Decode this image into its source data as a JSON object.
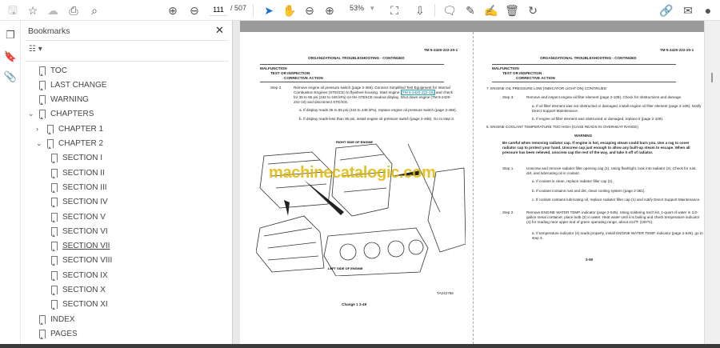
{
  "toolbar": {
    "page_current": "111",
    "page_total": "/ 507",
    "zoom": "53%"
  },
  "icons": [
    "save-icon",
    "bookmark-star-icon",
    "cloud-upload-icon",
    "print-icon",
    "search-zoom-icon",
    "page-up-icon",
    "page-down-icon",
    "select-cursor-icon",
    "hand-icon",
    "zoom-out-icon",
    "zoom-in-icon",
    "fit-page-icon",
    "scroll-mode-icon",
    "comment-icon",
    "highlight-pen-icon",
    "sign-icon",
    "delete-icon",
    "rotate-icon",
    "share-link-icon",
    "email-icon",
    "account-icon"
  ],
  "panel": {
    "title": "Bookmarks",
    "close": "✕"
  },
  "bookmarks": [
    {
      "label": "TOC",
      "level": 0,
      "chevron": ""
    },
    {
      "label": "LAST CHANGE",
      "level": 0,
      "chevron": ""
    },
    {
      "label": "WARNING",
      "level": 0,
      "chevron": ""
    },
    {
      "label": "CHAPTERS",
      "level": 0,
      "chevron": "⌄"
    },
    {
      "label": "CHAPTER 1",
      "level": 1,
      "chevron": "›"
    },
    {
      "label": "CHAPTER 2",
      "level": 1,
      "chevron": "⌄"
    },
    {
      "label": "SECTION I",
      "level": 2
    },
    {
      "label": "SECTION II",
      "level": 2
    },
    {
      "label": "SECTION III",
      "level": 2
    },
    {
      "label": "SECTION IV",
      "level": 2
    },
    {
      "label": "SECTION V",
      "level": 2
    },
    {
      "label": "SECTION VI",
      "level": 2
    },
    {
      "label": "SECTION VII",
      "level": 2
    },
    {
      "label": "SECTION VIII",
      "level": 2
    },
    {
      "label": "SECTION IX",
      "level": 2
    },
    {
      "label": "SECTION X",
      "level": 2
    },
    {
      "label": "SECTION XI",
      "level": 2
    },
    {
      "label": "INDEX",
      "level": 0,
      "chevron": ""
    },
    {
      "label": "PAGES",
      "level": 0,
      "chevron": ""
    }
  ],
  "left_page": {
    "tm": "TM 5-2420-222-20-1",
    "heading": "ORGANIZATIONAL TROUBLESHOOTING - CONTINUED",
    "col1": "MALFUNCTION",
    "col2": "TEST OR INSPECTION",
    "col3": "CORRECTIVE ACTION",
    "step": "Step 2.",
    "step_text_a": "Remove engine oil pressure switch (page 2-466). Connect Simplified Test Equipment for Internal Combustion Engines (STE/ICE) to flywheel housing. Start engine ",
    "step_link": "(TM 5-2420-222-10)",
    "step_text_b": " and check for 35 to 65 psi (242 to 448 kPa) on the STE/ICE readout display. Shut down engine (TM 5-2420-222-10) and disconnect STE/ICE.",
    "a": "a.  If display reads 35 to 65 psi (242 to 448 kPa), replace engine oil pressure switch (page 2-466).",
    "b": "b.  If display reads less than 35 psi, install engine oil pressure switch (page 2-466). Go to step 3.",
    "fig_right": "RIGHT SIDE OF ENGINE",
    "fig_left": "LEFT SIDE OF ENGINE",
    "fig_id": "TA242756",
    "footer": "Change 1  2-49",
    "watermark": "machinecatalogic.com"
  },
  "right_page": {
    "tm": "TM 5-2420-222-20-1",
    "heading": "ORGANIZATIONAL TROUBLESHOOTING - CONTINUED",
    "col1": "MALFUNCTION",
    "col2": "TEST OR INSPECTION",
    "col3": "CORRECTIVE ACTION",
    "item7": "7.   ENGINE OIL PRESSURE LOW (INDICATOR LIGHT ON) CONTINUED",
    "s3": "Step 3.",
    "s3_text": "Remove and inspect engine oil filter element (page 2-109). Check for obstructions and damage.",
    "s3a": "a.  If oil filter element was not obstructed or damaged, install engine oil filter element (page 2-109). Notify Direct Support Maintenance.",
    "s3b": "b.  If engine oil filter element was obstructed or damaged, replace it (page 2-109).",
    "item8": "8.   ENGINE COOLANT TEMPERATURE TOO HIGH (GAGE READS IN OVERHEAT RANGE)",
    "warning": "WARNING",
    "warning_text": "Be careful when removing radiator cap. If engine is hot, escaping steam could burn you. Use a rag to cover radiator cap to protect your hand. Unscrew cap just enough to allow any built-up steam to escape. When all pressure has been relieved, unscrew cap the rest of the way, and take it off of radiator.",
    "s1": "Step 1.",
    "s1_text": "Unscrew and remove radiator filler opening cap (1). Using flashlight, look into radiator (2). Check for rust, dirt, and lubricating oil in coolant.",
    "s1a": "a.  If coolant is clean, replace radiator filler cap (1).",
    "s1b": "b.  If coolant contains rust and dirt, clean cooling system (page 2-381).",
    "s1c": "c.  If coolant contains lubricating oil, replace radiator filler cap (1) and notify Direct Support Maintenance.",
    "s2": "Step 2.",
    "s2_text": "Remove ENGINE WATER TEMP. indicator (page 2-545). Using soldering torch kit, 1-quart of water in 1/2-gallon metal container, place bulb (3) in water. Heat water until it is boiling and check temperature indicator (4) for reading near upper end of green operating range, about 212ºF (100ºC).",
    "s2a": "a.  If temperature indicator (4) reads properly, install ENGINE WATER TEMP. indicator (page 2-545), go to step 3.",
    "footer": "2-50"
  }
}
